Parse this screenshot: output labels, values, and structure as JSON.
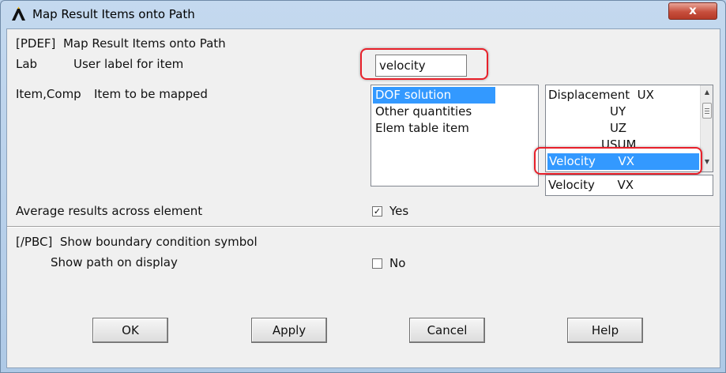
{
  "window": {
    "title": "Map Result Items onto Path",
    "close_glyph": "x"
  },
  "pdef": {
    "header": "[PDEF]  Map Result Items onto Path",
    "lab_label": "Lab",
    "lab_desc": "User label for item",
    "lab_value": "velocity",
    "item_label": "Item,Comp",
    "item_desc": "Item to be mapped",
    "item_list": [
      "DOF solution",
      "Other quantities",
      "Elem table item"
    ],
    "item_selected": "DOF solution",
    "comp_list": [
      {
        "cat": "Displacement",
        "comp": "UX"
      },
      {
        "cat": "",
        "comp": "UY"
      },
      {
        "cat": "",
        "comp": "UZ"
      },
      {
        "cat": "",
        "comp": "USUM"
      },
      {
        "cat": "Velocity",
        "comp": "VX"
      }
    ],
    "comp_selected": "Velocity      VX",
    "comp_current": "Velocity      VX",
    "avg_label": "Average results across element",
    "avg_checked": true,
    "avg_value": "Yes"
  },
  "pbc": {
    "header": "[/PBC]  Show boundary condition symbol",
    "path_label": "Show path on display",
    "path_checked": false,
    "path_value": "No"
  },
  "buttons": {
    "ok": "OK",
    "apply": "Apply",
    "cancel": "Cancel",
    "help": "Help"
  },
  "colors": {
    "selection": "#3399ff",
    "annotation": "#e8202a",
    "title_bg": "#b9d1ea",
    "close": "#c74f3d"
  },
  "icons": {
    "app": "ansys-logo-icon",
    "close": "close-icon",
    "scroll_up": "scroll-up-arrow-icon",
    "scroll_down": "scroll-down-arrow-icon",
    "check": "checkmark-icon"
  }
}
